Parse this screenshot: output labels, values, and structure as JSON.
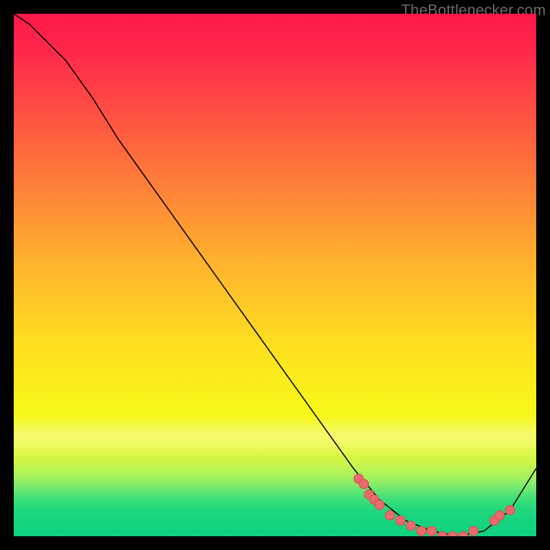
{
  "attribution": "TheBottlenecker.com",
  "colors": {
    "curve": "#000000",
    "marker": "#e96a6c",
    "marker_stroke": "#d84e52"
  },
  "chart_data": {
    "type": "line",
    "title": "",
    "xlabel": "",
    "ylabel": "",
    "xlim": [
      0,
      100
    ],
    "ylim": [
      0,
      100
    ],
    "series": [
      {
        "name": "bottleneck-curve",
        "x": [
          0,
          3,
          6,
          10,
          15,
          20,
          25,
          30,
          35,
          40,
          45,
          50,
          55,
          60,
          65,
          70,
          75,
          80,
          85,
          90,
          95,
          100
        ],
        "y": [
          100,
          98,
          95,
          91,
          84,
          76,
          69,
          62,
          55,
          48,
          41,
          34,
          27,
          20,
          13,
          7,
          3,
          1,
          0,
          1,
          5,
          13
        ]
      }
    ],
    "markers": [
      {
        "x": 66,
        "y": 11
      },
      {
        "x": 67,
        "y": 10
      },
      {
        "x": 68,
        "y": 8
      },
      {
        "x": 69,
        "y": 7
      },
      {
        "x": 70,
        "y": 6
      },
      {
        "x": 72,
        "y": 4
      },
      {
        "x": 74,
        "y": 3
      },
      {
        "x": 76,
        "y": 2
      },
      {
        "x": 78,
        "y": 1
      },
      {
        "x": 80,
        "y": 1
      },
      {
        "x": 82,
        "y": 0
      },
      {
        "x": 84,
        "y": 0
      },
      {
        "x": 86,
        "y": 0
      },
      {
        "x": 88,
        "y": 1
      },
      {
        "x": 92,
        "y": 3
      },
      {
        "x": 93,
        "y": 4
      },
      {
        "x": 95,
        "y": 5
      }
    ]
  }
}
